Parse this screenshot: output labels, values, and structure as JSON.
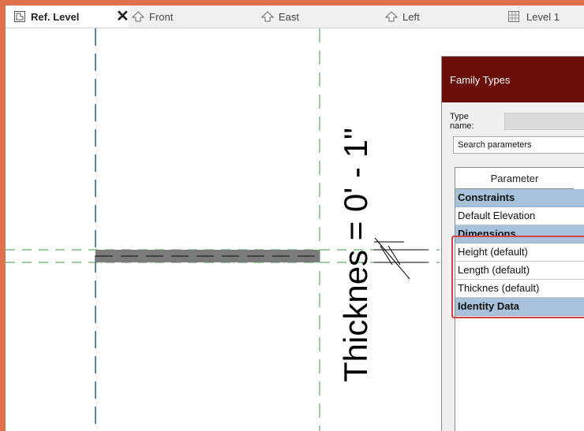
{
  "tabs": [
    {
      "label": "Ref. Level"
    },
    {
      "label": "Front"
    },
    {
      "label": "East"
    },
    {
      "label": "Left"
    },
    {
      "label": "Level 1"
    }
  ],
  "close_glyph": "✕",
  "dimension": {
    "text": "Thicknes = 0' - 1\""
  },
  "dialog": {
    "title": "Family Types",
    "type_name_label": "Type name:",
    "search_placeholder": "Search parameters",
    "column_parameter": "Parameter",
    "groups": [
      {
        "label": "Constraints",
        "rows": [
          "Default Elevation"
        ]
      },
      {
        "label": "Dimensions",
        "rows": [
          "Height (default)",
          "Length (default)",
          "Thicknes (default)"
        ]
      },
      {
        "label": "Identity Data",
        "rows": []
      }
    ]
  },
  "colors": {
    "frame": "#e0714f",
    "dialog_title_bg": "#6b0e08",
    "group_row_bg": "#a9c2dc",
    "highlight_border": "#d44343",
    "ref_plane_blue": "#2a6c9e",
    "ref_plane_green": "#3c9b3c",
    "element_fill": "#7a7a7a"
  },
  "icons": {
    "ref_level_tab": "floor-plan-icon",
    "elevation_tabs": "elevation-arrow-icon",
    "level_tab": "floor-plan-grid-icon"
  }
}
